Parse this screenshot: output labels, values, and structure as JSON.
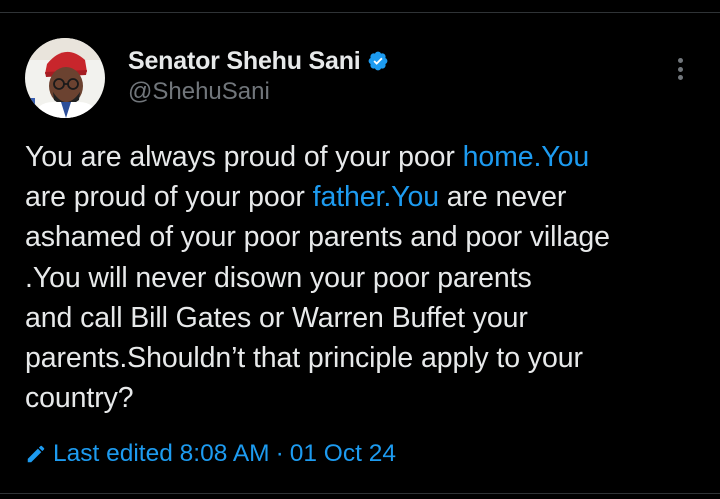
{
  "author": {
    "display_name": "Senator Shehu Sani",
    "handle": "@ShehuSani",
    "verified_icon": "verified-badge-icon",
    "avatar": "profile-avatar"
  },
  "tweet": {
    "line1_a": "You are always proud of your poor ",
    "line1_link": "home.You",
    "line2_a": "are proud of your poor ",
    "line2_link": "father.You",
    "line2_b": " are never",
    "line3": "ashamed of your poor parents and poor village",
    "line4": ".You will never disown your poor parents",
    "line5": "and call Bill Gates or Warren Buffet your",
    "line6": "parents.Shouldn’t that principle apply to your",
    "line7": "country?"
  },
  "edit_info": {
    "label": "Last edited 8:08 AM",
    "separator": "·",
    "date": "01 Oct 24",
    "icon": "pencil-icon"
  },
  "colors": {
    "background": "#000000",
    "text": "#e7e9ea",
    "secondary": "#71767b",
    "accent": "#1d9bf0"
  }
}
